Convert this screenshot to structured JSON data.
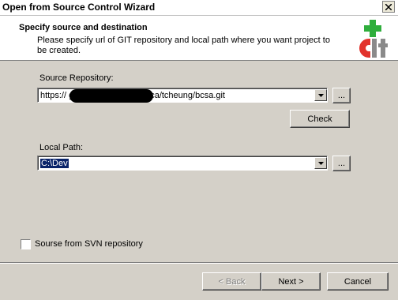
{
  "window": {
    "title": "Open from Source Control Wizard"
  },
  "header": {
    "title": "Specify source and destination",
    "description": "Please specify url of GIT repository and local path where you want project to be created."
  },
  "source": {
    "label": "Source Repository:",
    "value": "https://                              gitlab.safetyauthority.ca/tcheung/bcsa.git",
    "browse_label": "...",
    "check_label": "Check"
  },
  "local": {
    "label": "Local Path:",
    "value": "C:\\Dev",
    "browse_label": "..."
  },
  "svn": {
    "label": "Sourse from SVN repository",
    "checked": false
  },
  "buttons": {
    "back": "< Back",
    "next": "Next >",
    "cancel": "Cancel"
  },
  "colors": {
    "accent_green": "#2fae3c",
    "accent_red": "#e2332c",
    "selection": "#0a246a"
  }
}
